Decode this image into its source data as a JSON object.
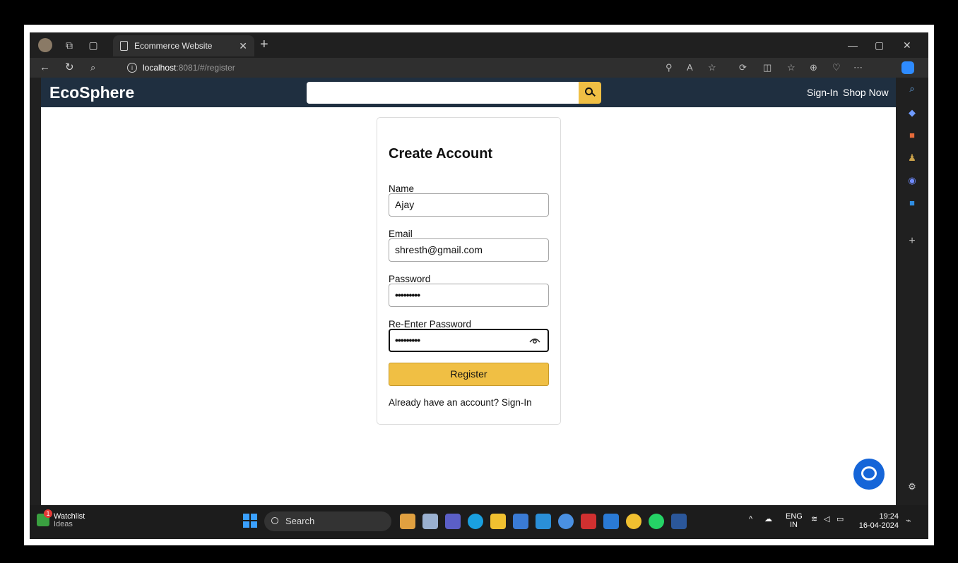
{
  "browser": {
    "tab_title": "Ecommerce Website",
    "url_host": "localhost",
    "url_path": ":8081/#/register"
  },
  "site": {
    "logo": "EcoSphere",
    "search_placeholder": "",
    "nav": [
      "Sign-In",
      "Shop Now"
    ]
  },
  "form": {
    "title": "Create Account",
    "name_label": "Name",
    "name_value": "Ajay",
    "email_label": "Email",
    "email_value": "shresth@gmail.com",
    "password_label": "Password",
    "password_value": "•••••••••",
    "reenter_label": "Re-Enter Password",
    "reenter_value": "•••••••••",
    "register_button": "Register",
    "signin_hint": "Already have an account? Sign-In"
  },
  "taskbar": {
    "widget_title": "Watchlist",
    "widget_subtitle": "Ideas",
    "widget_badge": "1",
    "search_label": "Search",
    "lang_top": "ENG",
    "lang_bottom": "IN",
    "time": "19:24",
    "date": "16-04-2024"
  },
  "icons": [
    "back-icon",
    "refresh-icon",
    "search-icon",
    "info-icon",
    "eye-icon",
    "chat-icon",
    "settings-icon"
  ],
  "colors": {
    "header_bg": "#1f2f40",
    "accent": "#f0bf44",
    "chat": "#1565d8"
  }
}
